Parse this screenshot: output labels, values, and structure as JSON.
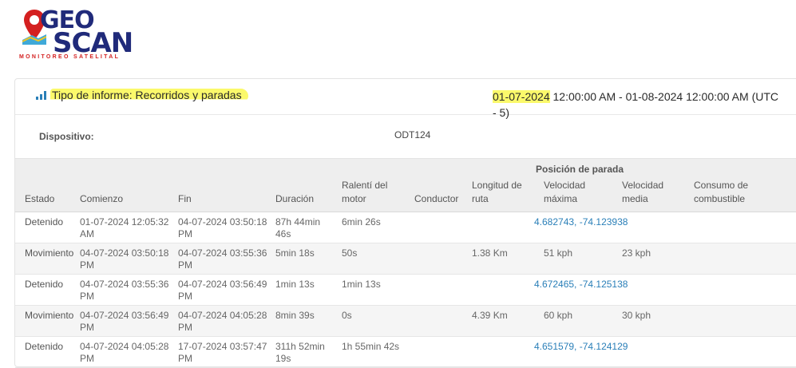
{
  "logo": {
    "line1": "GEO",
    "line2": "SCAN",
    "tagline": "MONITOREO SATELITAL"
  },
  "report": {
    "type_label": "Tipo de informe: Recorridos y paradas",
    "date_start_highlight": "01-07-2024",
    "date_rest": " 12:00:00 AM - 01-08-2024 12:00:00 AM (UTC - 5)",
    "device_label": "Dispositivo:",
    "device_value": "ODT124",
    "highlight_color": "#fbf96b"
  },
  "table": {
    "group_header": "Posición de parada",
    "columns": [
      "Estado",
      "Comienzo",
      "Fin",
      "Duración",
      "Ralentí del motor",
      "Conductor",
      "Longitud de ruta",
      "Velocidad máxima",
      "Velocidad media",
      "Consumo de combustible"
    ],
    "rows": [
      {
        "estado": "Detenido",
        "comienzo": "01-07-2024 12:05:32 AM",
        "fin": "04-07-2024 03:50:18 PM",
        "duracion": "87h 44min 46s",
        "ralenti": "6min 26s",
        "conductor": "",
        "longitud": "",
        "vmax": "4.682743, -74.123938",
        "vmedia": "",
        "consumo": ""
      },
      {
        "estado": "Movimiento",
        "comienzo": "04-07-2024 03:50:18 PM",
        "fin": "04-07-2024 03:55:36 PM",
        "duracion": "5min 18s",
        "ralenti": "50s",
        "conductor": "",
        "longitud": "1.38 Km",
        "vmax": "51 kph",
        "vmedia": "23 kph",
        "consumo": ""
      },
      {
        "estado": "Detenido",
        "comienzo": "04-07-2024 03:55:36 PM",
        "fin": "04-07-2024 03:56:49 PM",
        "duracion": "1min 13s",
        "ralenti": "1min 13s",
        "conductor": "",
        "longitud": "",
        "vmax": "4.672465, -74.125138",
        "vmedia": "",
        "consumo": ""
      },
      {
        "estado": "Movimiento",
        "comienzo": "04-07-2024 03:56:49 PM",
        "fin": "04-07-2024 04:05:28 PM",
        "duracion": "8min 39s",
        "ralenti": "0s",
        "conductor": "",
        "longitud": "4.39 Km",
        "vmax": "60 kph",
        "vmedia": "30 kph",
        "consumo": ""
      },
      {
        "estado": "Detenido",
        "comienzo": "04-07-2024 04:05:28 PM",
        "fin": "17-07-2024 03:57:47 PM",
        "duracion": "311h 52min 19s",
        "ralenti": "1h 55min 42s",
        "conductor": "",
        "longitud": "",
        "vmax": "4.651579, -74.124129",
        "vmedia": "",
        "consumo": ""
      }
    ],
    "link_color": "#2a7fb8"
  }
}
